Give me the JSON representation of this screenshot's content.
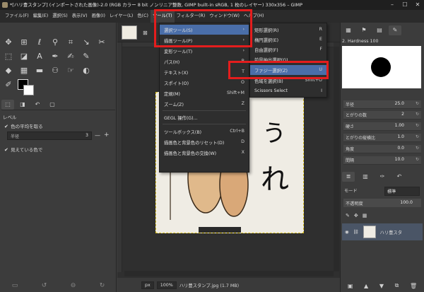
{
  "window": {
    "title": "*[ハリ豊スタンプ] (インポートされた画像)-2.0 (RGB カラー 8 bit ノンリニア整数, GIMP built-in sRGB, 1 枚のレイヤー) 330x356 – GIMP"
  },
  "menubar": [
    "ファイル(F)",
    "編集(E)",
    "選択(S)",
    "表示(V)",
    "画像(I)",
    "レイヤー(L)",
    "色(C)",
    "ツール(T)",
    "フィルター(R)",
    "ウィンドウ(W)",
    "ヘルプ(H)"
  ],
  "tool_options": {
    "section": "レベル",
    "sample_average": "色の平均を取る",
    "radius_label": "半径",
    "radius_value": "3",
    "sample_visible": "見えている色で"
  },
  "tools_menu": {
    "items": [
      {
        "label": "選択ツール(S)",
        "shortcut": ""
      },
      {
        "label": "描画ツール(P)",
        "shortcut": ""
      },
      {
        "label": "変形ツール(T)",
        "shortcut": ""
      },
      {
        "label": "パス(H)",
        "shortcut": "B"
      },
      {
        "label": "テキスト(X)",
        "shortcut": "T"
      },
      {
        "label": "スポイト(O)",
        "shortcut": "O"
      },
      {
        "label": "定規(M)",
        "shortcut": "Shift+M"
      },
      {
        "label": "ズーム(Z)",
        "shortcut": "Z"
      },
      {
        "label": "GEGL 操作(G)...",
        "shortcut": ""
      },
      {
        "label": "ツールボックス(B)",
        "shortcut": "Ctrl+B"
      },
      {
        "label": "描画色と背景色のリセット(D)",
        "shortcut": "D"
      },
      {
        "label": "描画色と背景色の交換(W)",
        "shortcut": "X"
      }
    ]
  },
  "select_submenu": {
    "items": [
      {
        "label": "矩形選択(R)",
        "shortcut": "R"
      },
      {
        "label": "楕円選択(E)",
        "shortcut": "E"
      },
      {
        "label": "自由選択(F)",
        "shortcut": "F"
      },
      {
        "label": "前景抽出選択(G)",
        "shortcut": ""
      },
      {
        "label": "ファジー選択(Z)",
        "shortcut": "U"
      },
      {
        "label": "色域を選択(B)",
        "shortcut": "Shift+O"
      },
      {
        "label": "Scissors Select",
        "shortcut": "I"
      }
    ]
  },
  "image_text": {
    "line1": "う",
    "line2": "れ"
  },
  "statusbar": {
    "unit": "px",
    "zoom": "100%",
    "filename": "ハリ豊スタンプ.jpg (1.7 MB)"
  },
  "brushes": {
    "name": "2. Hardness 100"
  },
  "brush_params": [
    {
      "label": "半径",
      "value": "25.0"
    },
    {
      "label": "とがりの数",
      "value": "2"
    },
    {
      "label": "硬さ",
      "value": "1.00"
    },
    {
      "label": "とがりの縦横比",
      "value": "1.0"
    },
    {
      "label": "角度",
      "value": "0.0"
    },
    {
      "label": "間隔",
      "value": "10.0"
    }
  ],
  "layers": {
    "mode_label": "モード",
    "mode_value": "標準",
    "opacity_label": "不透明度",
    "opacity_value": "100.0",
    "layer_name": "ハリ豊スタ"
  },
  "colors": {
    "highlight": "#4a6ea9",
    "annotation_red": "#e41d1d",
    "menu_bg": "#2e2e2e"
  }
}
